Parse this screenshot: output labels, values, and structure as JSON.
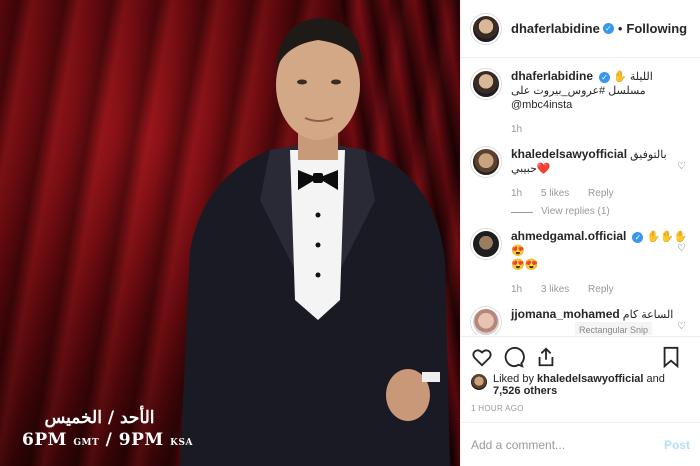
{
  "post": {
    "caption_days": "الأحد / الخميس",
    "caption_time_1": "6PM",
    "caption_tz_1": "GMT",
    "caption_time_2": "9PM",
    "caption_tz_2": "KSA"
  },
  "header": {
    "username": "dhaferlabidine",
    "follow_label": "Following",
    "separator": "•"
  },
  "comments": [
    {
      "username": "dhaferlabidine",
      "text_line1": "الليلة ✋",
      "text_line2": "مسلسل #عروس_بيروت على",
      "text_line3": "@mbc4insta",
      "time": "1h"
    },
    {
      "username": "khaledelsawyofficial",
      "text_inline": "بالتوفيق",
      "text_line2": "❤️حبيبي",
      "time": "1h",
      "likes": "5 likes",
      "reply": "Reply",
      "view_replies": "View replies (1)"
    },
    {
      "username": "ahmedgamal.official",
      "text_inline": "✋✋✋😍",
      "text_line2": "😍😍",
      "time": "1h",
      "likes": "3 likes",
      "reply": "Reply"
    },
    {
      "username": "jjomana_mohamed",
      "text_inline": "الساعة كام",
      "overlay": "Rectangular Snip"
    }
  ],
  "likes": {
    "prefix": "Liked by",
    "user": "khaledelsawyofficial",
    "connector": "and",
    "count": "7,526 others"
  },
  "timestamp": "1 HOUR AGO",
  "add_comment": {
    "placeholder": "Add a comment...",
    "post_label": "Post"
  },
  "colors": {
    "verified": "#3897f0",
    "curtain": "#6a0a10"
  }
}
